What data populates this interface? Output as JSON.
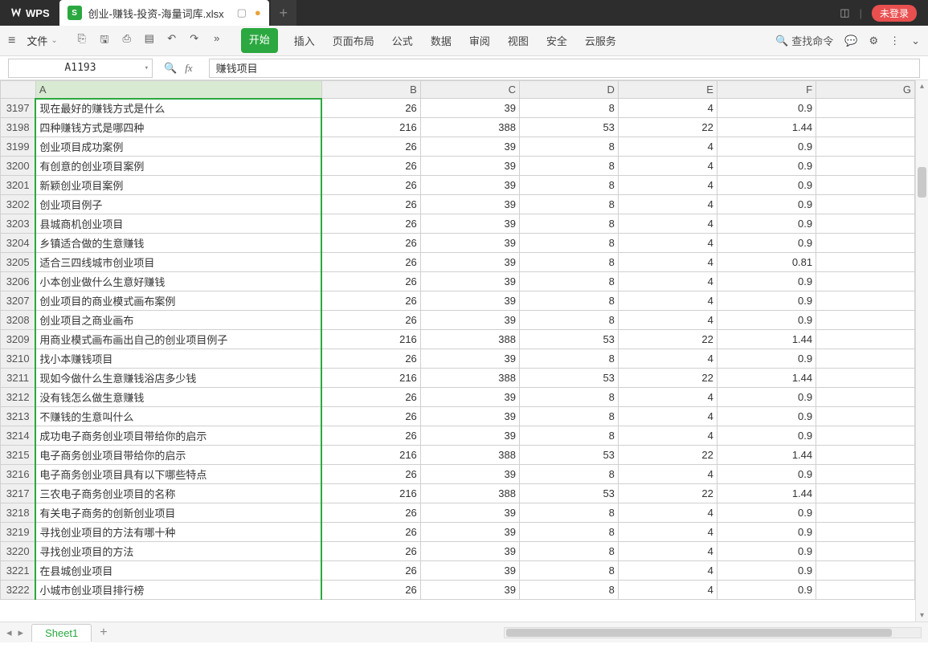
{
  "title": {
    "app": "WPS",
    "doc": "创业-赚钱-投资-海量词库.xlsx",
    "login": "未登录"
  },
  "menubar": {
    "file": "文件",
    "tabs": [
      "开始",
      "插入",
      "页面布局",
      "公式",
      "数据",
      "审阅",
      "视图",
      "安全",
      "云服务"
    ],
    "search": "查找命令"
  },
  "fx": {
    "cell": "A1193",
    "value": "赚钱项目"
  },
  "columns": [
    "A",
    "B",
    "C",
    "D",
    "E",
    "F",
    "G"
  ],
  "rows": [
    {
      "n": 3197,
      "a": "现在最好的赚钱方式是什么",
      "b": 26,
      "c": 39,
      "d": 8,
      "e": 4,
      "f": "0.9"
    },
    {
      "n": 3198,
      "a": "四种赚钱方式是哪四种",
      "b": 216,
      "c": 388,
      "d": 53,
      "e": 22,
      "f": "1.44"
    },
    {
      "n": 3199,
      "a": "创业项目成功案例",
      "b": 26,
      "c": 39,
      "d": 8,
      "e": 4,
      "f": "0.9"
    },
    {
      "n": 3200,
      "a": "有创意的创业项目案例",
      "b": 26,
      "c": 39,
      "d": 8,
      "e": 4,
      "f": "0.9"
    },
    {
      "n": 3201,
      "a": "新颖创业项目案例",
      "b": 26,
      "c": 39,
      "d": 8,
      "e": 4,
      "f": "0.9"
    },
    {
      "n": 3202,
      "a": "创业项目例子",
      "b": 26,
      "c": 39,
      "d": 8,
      "e": 4,
      "f": "0.9"
    },
    {
      "n": 3203,
      "a": "县城商机创业项目",
      "b": 26,
      "c": 39,
      "d": 8,
      "e": 4,
      "f": "0.9"
    },
    {
      "n": 3204,
      "a": "乡镇适合做的生意赚钱",
      "b": 26,
      "c": 39,
      "d": 8,
      "e": 4,
      "f": "0.9"
    },
    {
      "n": 3205,
      "a": "适合三四线城市创业项目",
      "b": 26,
      "c": 39,
      "d": 8,
      "e": 4,
      "f": "0.81"
    },
    {
      "n": 3206,
      "a": "小本创业做什么生意好赚钱",
      "b": 26,
      "c": 39,
      "d": 8,
      "e": 4,
      "f": "0.9"
    },
    {
      "n": 3207,
      "a": "创业项目的商业模式画布案例",
      "b": 26,
      "c": 39,
      "d": 8,
      "e": 4,
      "f": "0.9"
    },
    {
      "n": 3208,
      "a": "创业项目之商业画布",
      "b": 26,
      "c": 39,
      "d": 8,
      "e": 4,
      "f": "0.9"
    },
    {
      "n": 3209,
      "a": "用商业模式画布画出自己的创业项目例子",
      "b": 216,
      "c": 388,
      "d": 53,
      "e": 22,
      "f": "1.44"
    },
    {
      "n": 3210,
      "a": "找小本赚钱项目",
      "b": 26,
      "c": 39,
      "d": 8,
      "e": 4,
      "f": "0.9"
    },
    {
      "n": 3211,
      "a": "现如今做什么生意赚钱浴店多少钱",
      "b": 216,
      "c": 388,
      "d": 53,
      "e": 22,
      "f": "1.44"
    },
    {
      "n": 3212,
      "a": "没有钱怎么做生意赚钱",
      "b": 26,
      "c": 39,
      "d": 8,
      "e": 4,
      "f": "0.9"
    },
    {
      "n": 3213,
      "a": "不赚钱的生意叫什么",
      "b": 26,
      "c": 39,
      "d": 8,
      "e": 4,
      "f": "0.9"
    },
    {
      "n": 3214,
      "a": "成功电子商务创业项目带给你的启示",
      "b": 26,
      "c": 39,
      "d": 8,
      "e": 4,
      "f": "0.9"
    },
    {
      "n": 3215,
      "a": "电子商务创业项目带给你的启示",
      "b": 216,
      "c": 388,
      "d": 53,
      "e": 22,
      "f": "1.44"
    },
    {
      "n": 3216,
      "a": "电子商务创业项目具有以下哪些特点",
      "b": 26,
      "c": 39,
      "d": 8,
      "e": 4,
      "f": "0.9"
    },
    {
      "n": 3217,
      "a": "三农电子商务创业项目的名称",
      "b": 216,
      "c": 388,
      "d": 53,
      "e": 22,
      "f": "1.44"
    },
    {
      "n": 3218,
      "a": "有关电子商务的创新创业项目",
      "b": 26,
      "c": 39,
      "d": 8,
      "e": 4,
      "f": "0.9"
    },
    {
      "n": 3219,
      "a": "寻找创业项目的方法有哪十种",
      "b": 26,
      "c": 39,
      "d": 8,
      "e": 4,
      "f": "0.9"
    },
    {
      "n": 3220,
      "a": "寻找创业项目的方法",
      "b": 26,
      "c": 39,
      "d": 8,
      "e": 4,
      "f": "0.9"
    },
    {
      "n": 3221,
      "a": "在县城创业项目",
      "b": 26,
      "c": 39,
      "d": 8,
      "e": 4,
      "f": "0.9"
    },
    {
      "n": 3222,
      "a": "小城市创业项目排行榜",
      "b": 26,
      "c": 39,
      "d": 8,
      "e": 4,
      "f": "0.9"
    }
  ],
  "sheet": {
    "name": "Sheet1"
  }
}
